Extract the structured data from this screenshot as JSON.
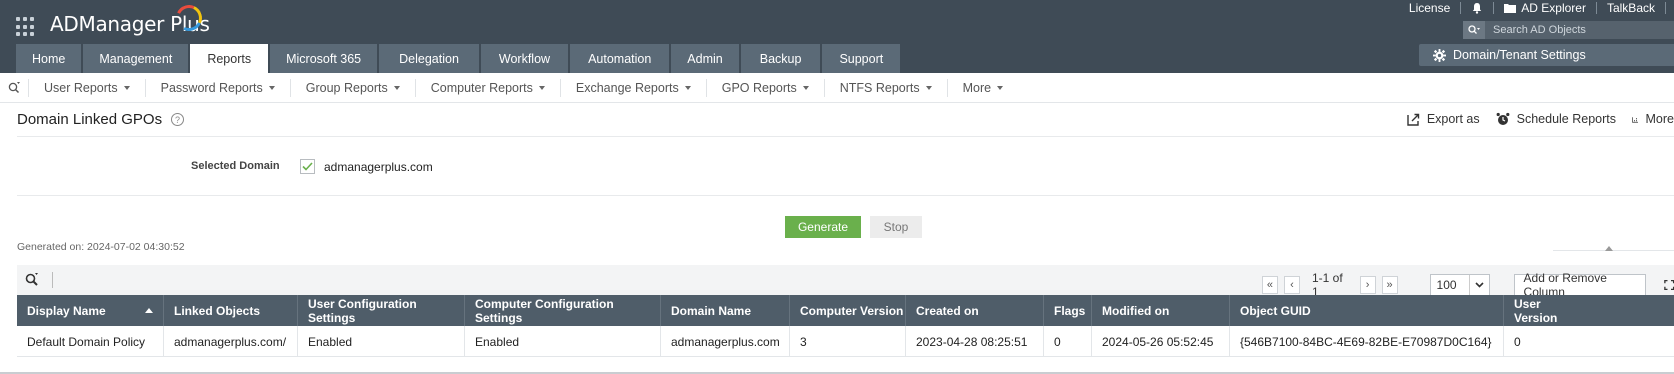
{
  "header": {
    "app_name": "ADManager Plus",
    "top_links": {
      "license": "License",
      "ad_explorer": "AD Explorer",
      "talkback": "TalkBack"
    },
    "search_placeholder": "Search AD Objects",
    "tabs": [
      {
        "label": "Home",
        "active": false
      },
      {
        "label": "Management",
        "active": false
      },
      {
        "label": "Reports",
        "active": true
      },
      {
        "label": "Microsoft 365",
        "active": false
      },
      {
        "label": "Delegation",
        "active": false
      },
      {
        "label": "Workflow",
        "active": false
      },
      {
        "label": "Automation",
        "active": false
      },
      {
        "label": "Admin",
        "active": false
      },
      {
        "label": "Backup",
        "active": false
      },
      {
        "label": "Support",
        "active": false
      }
    ],
    "domain_settings_label": "Domain/Tenant Settings"
  },
  "subnav": {
    "items": [
      "User Reports",
      "Password Reports",
      "Group Reports",
      "Computer Reports",
      "Exchange Reports",
      "GPO Reports",
      "NTFS Reports",
      "More"
    ]
  },
  "page": {
    "title": "Domain Linked GPOs",
    "help": "?",
    "actions": {
      "export": "Export as",
      "schedule": "Schedule Reports",
      "more": "More"
    },
    "selected_domain_label": "Selected Domain",
    "selected_domain_value": "admanagerplus.com",
    "generate_label": "Generate",
    "stop_label": "Stop",
    "generated_on": "Generated on: 2024-07-02 04:30:52"
  },
  "toolbar": {
    "page_info": "1-1 of 1",
    "page_size": "100",
    "add_remove_label": "Add or Remove Column"
  },
  "table": {
    "columns": [
      "Display Name",
      "Linked Objects",
      "User Configuration Settings",
      "Computer Configuration Settings",
      "Domain Name",
      "Computer Version",
      "Created on",
      "Flags",
      "Modified on",
      "Object GUID",
      "User Version"
    ],
    "rows": [
      [
        "Default Domain Policy",
        "admanagerplus.com/",
        "Enabled",
        "Enabled",
        "admanagerplus.com",
        "3",
        "2023-04-28 08:25:51",
        "0",
        "2024-05-26 05:52:45",
        "{546B7100-84BC-4E69-82BE-E70987D0C164}",
        "0"
      ]
    ]
  }
}
